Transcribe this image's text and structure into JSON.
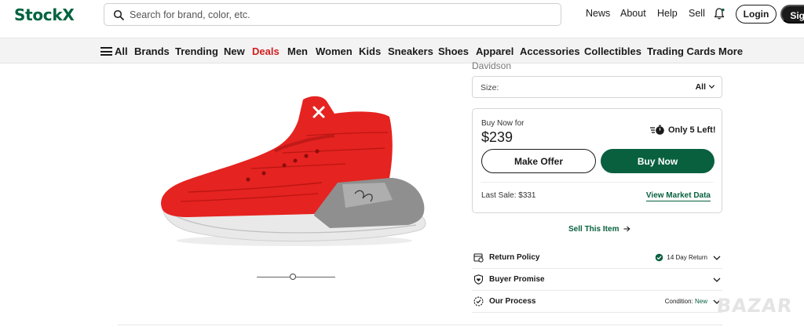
{
  "header": {
    "logo": "StockX",
    "search_placeholder": "Search for brand, color, etc.",
    "links": [
      "News",
      "About",
      "Help",
      "Sell"
    ],
    "login_label": "Login",
    "signup_label": "Sign Up"
  },
  "nav": {
    "all_label": "All",
    "items": [
      "Brands",
      "Trending",
      "New",
      "Deals",
      "Men",
      "Women",
      "Kids",
      "Sneakers",
      "Shoes",
      "Apparel",
      "Accessories",
      "Collectibles",
      "Trading Cards",
      "More"
    ],
    "highlight_color": "#d11f1f"
  },
  "product": {
    "title_fragment": "Davidson",
    "size_label": "Size:",
    "size_value": "All",
    "buy_now_for_label": "Buy Now for",
    "price": "$239",
    "stock_text": "Only 5 Left!",
    "make_offer_label": "Make Offer",
    "buy_now_label": "Buy Now",
    "last_sale_label": "Last Sale: $331",
    "market_data_label": "View Market Data",
    "sell_link": "Sell This Item"
  },
  "info_rows": [
    {
      "label": "Return Policy",
      "meta": "14 Day Return",
      "icon": "return-policy-icon"
    },
    {
      "label": "Buyer Promise",
      "meta": "",
      "icon": "shield-heart-icon"
    },
    {
      "label": "Our Process",
      "meta_prefix": "Condition:",
      "meta_value": "New",
      "icon": "check-badge-icon"
    }
  ],
  "watermark": "BAZAR",
  "colors": {
    "brand_green": "#006340",
    "button_green": "#08603f",
    "deals_red": "#d11f1f"
  }
}
